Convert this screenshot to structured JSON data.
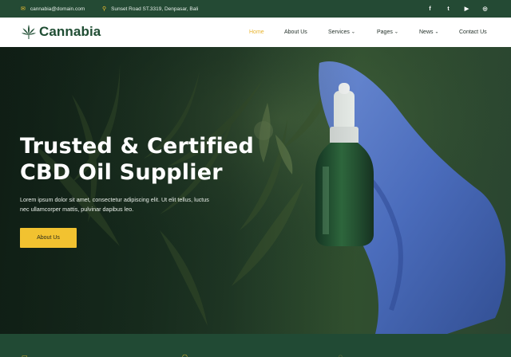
{
  "topbar": {
    "email": "cannabia@domain.com",
    "address": "Sunset Road ST.3319, Denpasar, Bali",
    "email_icon": "envelope-icon",
    "address_icon": "map-pin-icon",
    "socials": [
      {
        "name": "facebook-icon",
        "glyph": "f"
      },
      {
        "name": "twitter-icon",
        "glyph": "t"
      },
      {
        "name": "youtube-icon",
        "glyph": "▶"
      },
      {
        "name": "instagram-icon",
        "glyph": "◎"
      }
    ]
  },
  "brand": {
    "logo_text": "Cannabia",
    "logo_icon": "cannabis-leaf-icon",
    "color": "#1f4d33"
  },
  "nav": {
    "items": [
      {
        "label": "Home",
        "active": true,
        "dropdown": false
      },
      {
        "label": "About Us",
        "active": false,
        "dropdown": false
      },
      {
        "label": "Services",
        "active": false,
        "dropdown": true
      },
      {
        "label": "Pages",
        "active": false,
        "dropdown": true
      },
      {
        "label": "News",
        "active": false,
        "dropdown": true
      },
      {
        "label": "Contact Us",
        "active": false,
        "dropdown": false
      }
    ],
    "active_color": "#e9b531"
  },
  "hero": {
    "title_line1": "Trusted & Certified",
    "title_line2": "CBD Oil Supplier",
    "description": "Lorem ipsum dolor sit amet, consectetur adipiscing elit. Ut elit tellus, luctus nec ullamcorper mattis, pulvinar dapibus leo.",
    "button_label": "About Us",
    "button_color": "#f2c230"
  },
  "bottom": {
    "background": "#214a34",
    "icons": [
      "certificate-icon",
      "badge-icon",
      "shield-icon"
    ]
  }
}
